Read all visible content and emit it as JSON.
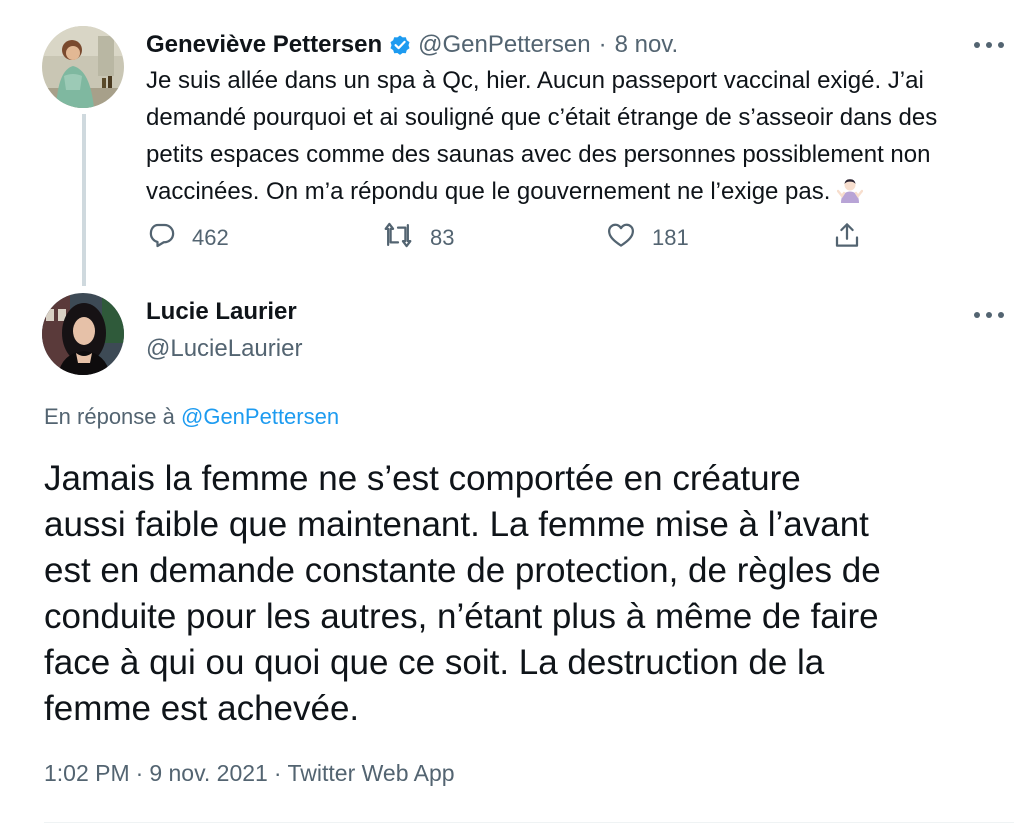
{
  "tweet1": {
    "author_name": "Geneviève Pettersen",
    "handle": "@GenPettersen",
    "separator": "·",
    "date": "8 nov.",
    "text": "Je suis allée dans un spa à Qc, hier. Aucun passeport vaccinal exigé. J’ai\ndemandé pourquoi et ai souligné que c’était étrange de s’asseoir dans des\npetits espaces comme des saunas avec des personnes possiblement non\nvaccinées. On m’a répondu que le gouvernement ne l’exige pas.",
    "emoji": "person-shrugging-emoji",
    "verified_icon": "verified-badge-icon",
    "stats": {
      "replies": "462",
      "retweets": "83",
      "likes": "181"
    }
  },
  "tweet2": {
    "author_name": "Lucie Laurier",
    "handle": "@LucieLaurier",
    "reply_prefix": "En réponse à",
    "reply_to": "@GenPettersen",
    "text": "Jamais la femme ne s’est comportée en créature\naussi faible que maintenant. La femme mise à l’avant\nest en demande constante de protection, de règles de\nconduite pour les autres, n’étant plus à même de faire\nface à qui ou quoi que ce soit. La destruction de la\nfemme est achevée.",
    "time": "1:02 PM",
    "date": "9 nov. 2021",
    "source": "Twitter Web App",
    "separator": "·"
  },
  "icons": {
    "reply": "reply-icon",
    "retweet": "retweet-icon",
    "like": "heart-icon",
    "share": "share-icon",
    "more": "more-options-icon"
  },
  "colors": {
    "text": "#0f1419",
    "secondary": "#536471",
    "link": "#1d9bf0",
    "verified": "#1d9bf0",
    "thread_line": "#cfd9de"
  }
}
